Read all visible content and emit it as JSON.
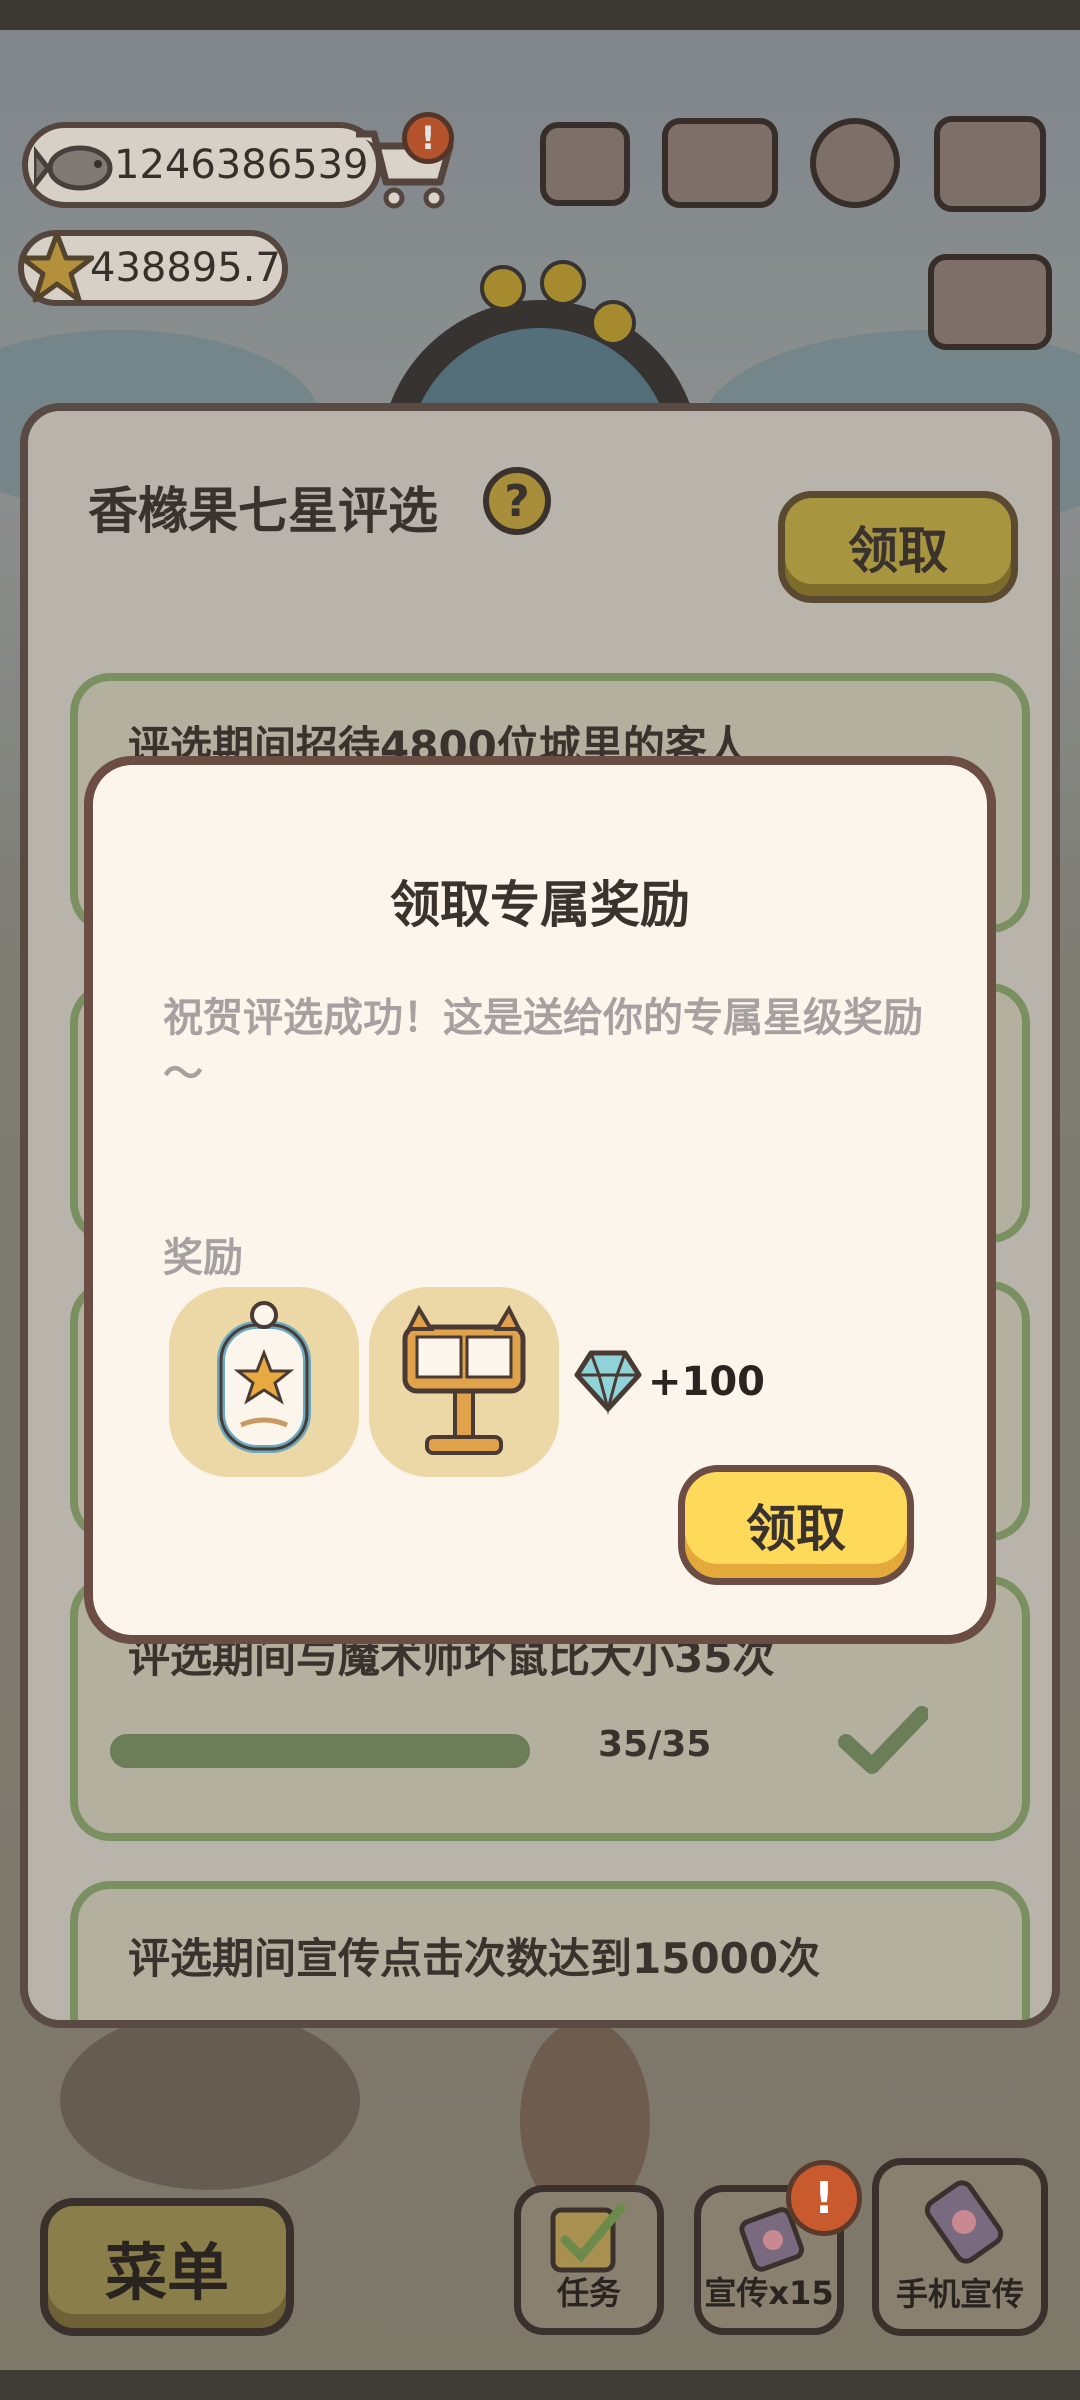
{
  "hud": {
    "fish_count": "1246386539",
    "star_count": "438895.7",
    "cart_alert": "!"
  },
  "panel": {
    "title": "香橼果七星评选",
    "help_label": "?",
    "claim_label": "领取",
    "tasks": [
      {
        "label": "评选期间招待4800位城里的客人"
      },
      {
        "label": "评选期间与魔术师坏鼠比大小35次",
        "progress_text": "35/35",
        "progress": 1.0
      },
      {
        "label": "评选期间宣传点击次数达到15000次"
      }
    ]
  },
  "modal": {
    "title": "领取专属奖励",
    "message": "祝贺评选成功！这是送给你的专属星级奖励～",
    "reward_label": "奖励",
    "rewards": [
      {
        "icon": "star-badge-icon"
      },
      {
        "icon": "book-lectern-icon"
      }
    ],
    "gem_amount": "+100",
    "claim_label": "领取"
  },
  "bottom": {
    "menu_label": "菜单",
    "task_label": "任务",
    "promo_label": "宣传x15",
    "promo_alert": "!",
    "phone_promo_label": "手机宣传"
  },
  "colors": {
    "modal_bg": "#fcf5ec",
    "claim_yellow": "#ffd95a",
    "task_border": "#7a9060",
    "alert_orange": "#c85a2e"
  }
}
